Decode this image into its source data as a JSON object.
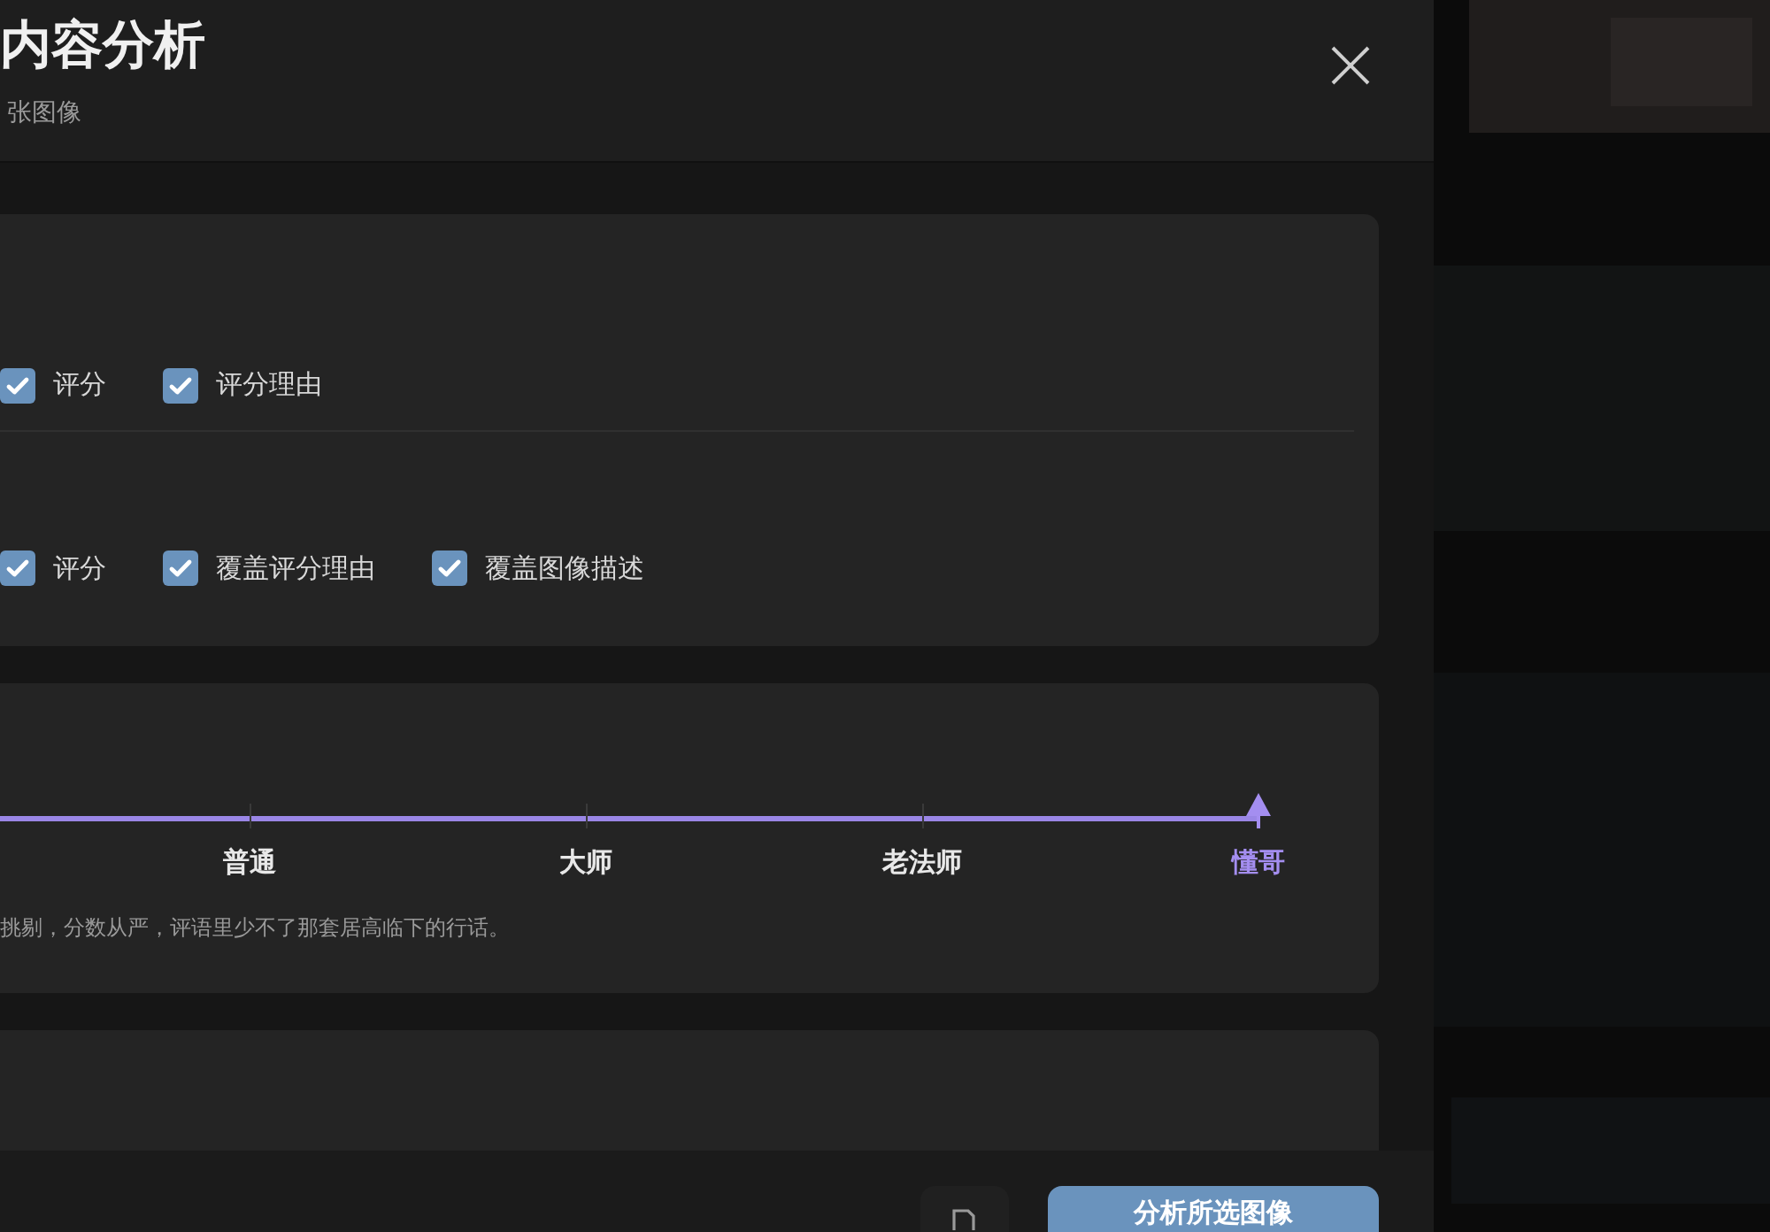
{
  "dialog": {
    "title": "内容分析",
    "subtitle": "张图像"
  },
  "output_fields": [
    {
      "label": "评分",
      "checked": true
    },
    {
      "label": "评分理由",
      "checked": true
    }
  ],
  "overwrite_fields": [
    {
      "label": "评分",
      "checked": true
    },
    {
      "label": "覆盖评分理由",
      "checked": true
    },
    {
      "label": "覆盖图像描述",
      "checked": true
    }
  ],
  "persona": {
    "levels": [
      {
        "label": "普通",
        "selected": false
      },
      {
        "label": "大师",
        "selected": false
      },
      {
        "label": "老法师",
        "selected": false
      },
      {
        "label": "懂哥",
        "selected": true
      }
    ],
    "description": "挑剔，分数从严，评语里少不了那套居高临下的行话。"
  },
  "footer": {
    "primary_button": "分析所选图像"
  }
}
